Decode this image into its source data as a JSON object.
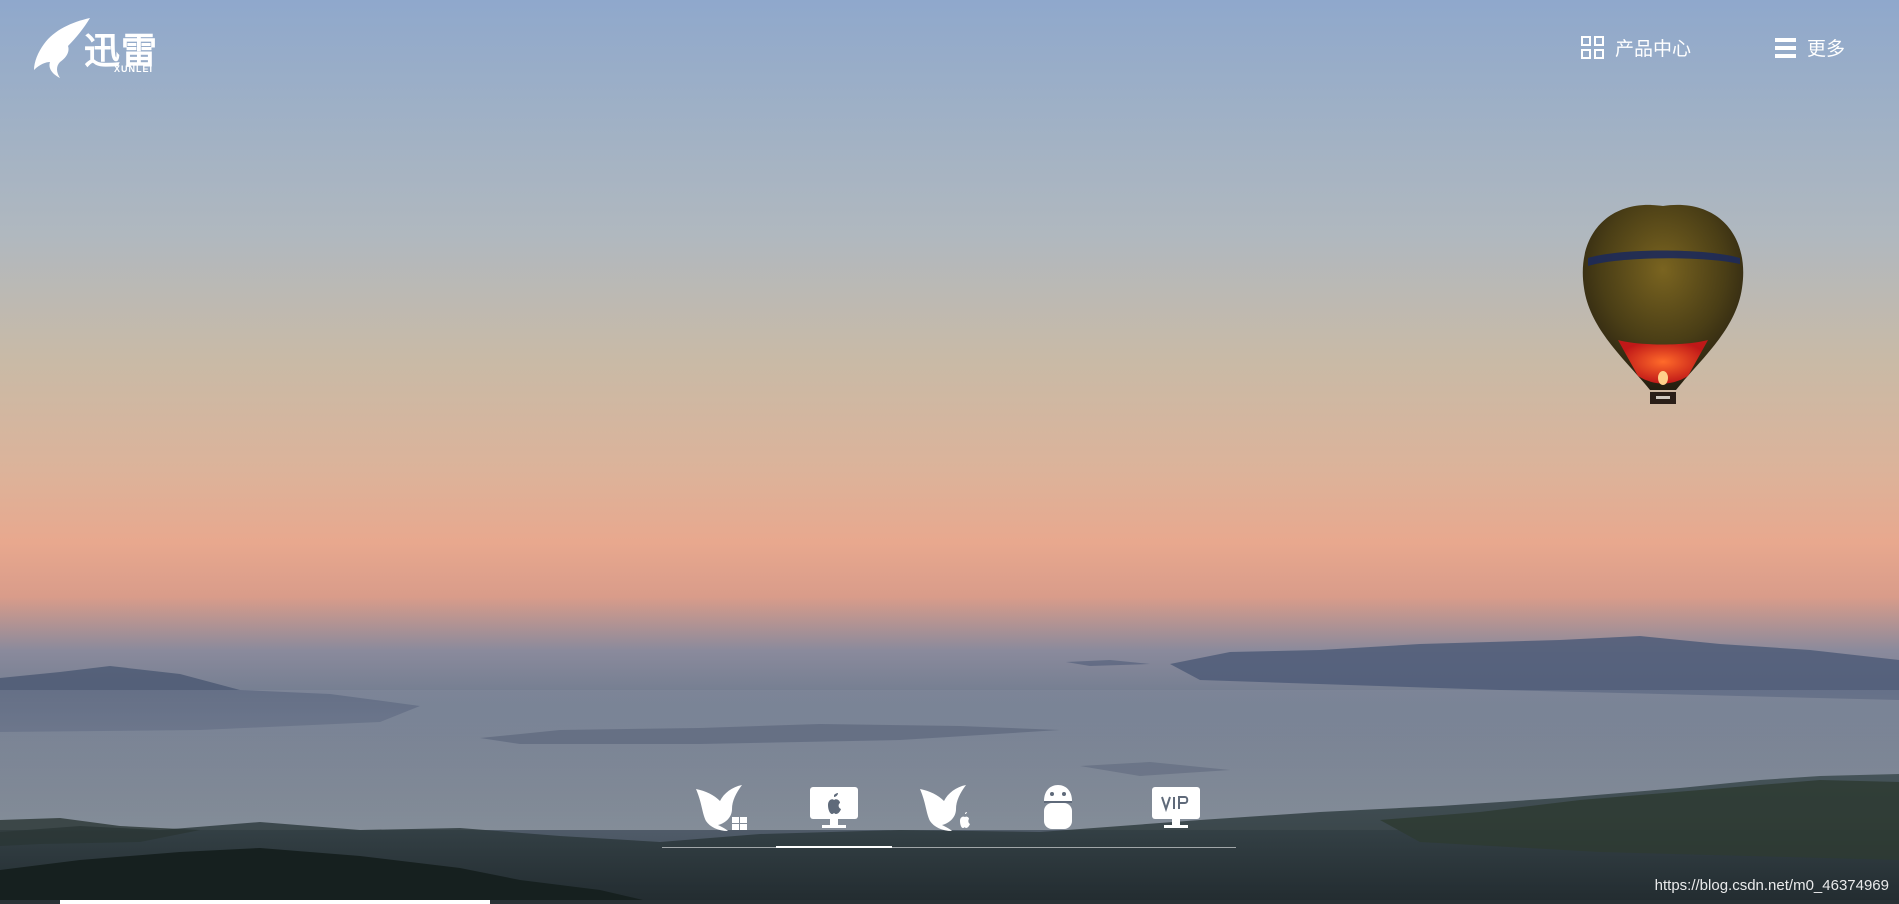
{
  "brand": {
    "logo_text": "迅雷",
    "logo_sub": "XUNLEI"
  },
  "nav": {
    "products_label": "产品中心",
    "more_label": "更多"
  },
  "downloads": [
    {
      "icon": "xunlei-windows-icon"
    },
    {
      "icon": "mac-desktop-icon"
    },
    {
      "icon": "xunlei-ios-icon"
    },
    {
      "icon": "android-icon"
    },
    {
      "icon": "vip-desktop-icon"
    }
  ],
  "watermark": "https://blog.csdn.net/m0_46374969",
  "colors": {
    "text": "#ffffff",
    "balloon_top": "#2a2a1a",
    "balloon_body": "#6e5a1c",
    "balloon_glow": "#e0261c"
  }
}
